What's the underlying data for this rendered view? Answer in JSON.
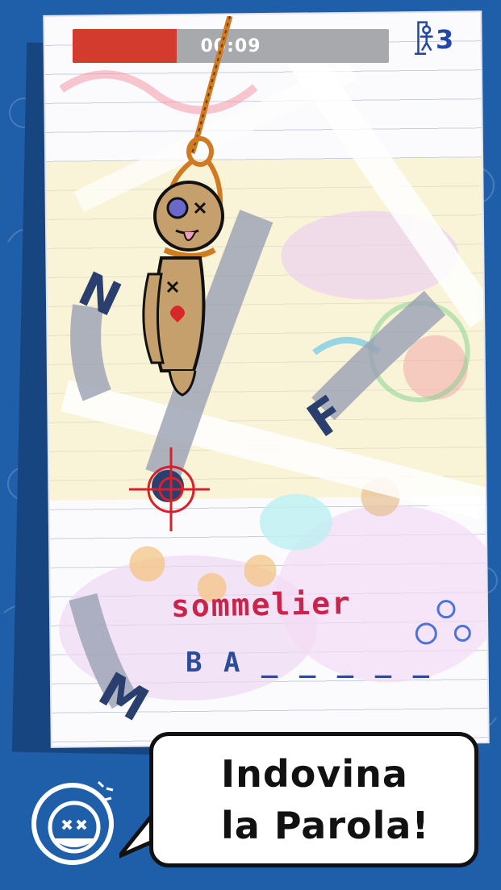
{
  "timer": {
    "text": "00:09",
    "remaining_fraction": 0.33
  },
  "lives": {
    "count": "3"
  },
  "letters": {
    "n": "N",
    "f": "F",
    "m": "M"
  },
  "puzzle": {
    "clue": "sommelier",
    "answer_pattern": "B A _ _ _ _ _"
  },
  "banner": {
    "line1": "Indovina",
    "line2": "la Parola!"
  },
  "colors": {
    "background": "#1f5ea8",
    "timer_fill": "#d23b2e",
    "clue": "#c9254c",
    "answer": "#2b4b9b"
  }
}
